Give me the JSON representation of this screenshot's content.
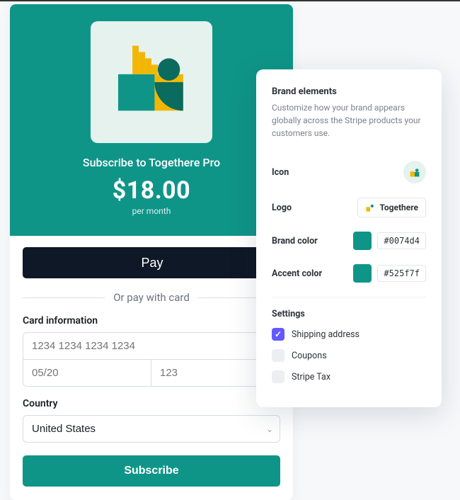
{
  "checkout": {
    "subscribe_to": "Subscribe to Togethere Pro",
    "price": "$18.00",
    "period": "per month",
    "apple_pay_label": "Pay",
    "divider_text": "Or pay with card",
    "card_section_label": "Card information",
    "card_number_placeholder": "1234 1234 1234 1234",
    "card_expiry_placeholder": "05/20",
    "card_cvc_placeholder": "123",
    "country_label": "Country",
    "country_selected": "United States",
    "subscribe_button": "Subscribe"
  },
  "brand_panel": {
    "title": "Brand elements",
    "description": "Customize how your brand appears globally across the Stripe products your customers use.",
    "icon_label": "Icon",
    "logo_label": "Logo",
    "logo_text": "Togethere",
    "brand_color_label": "Brand color",
    "brand_color_value": "#0074d4",
    "brand_color_swatch": "#0f9588",
    "accent_color_label": "Accent color",
    "accent_color_value": "#525f7f",
    "accent_color_swatch": "#0f9588",
    "settings_title": "Settings",
    "settings": [
      {
        "label": "Shipping address",
        "checked": true
      },
      {
        "label": "Coupons",
        "checked": false
      },
      {
        "label": "Stripe Tax",
        "checked": false
      }
    ]
  }
}
